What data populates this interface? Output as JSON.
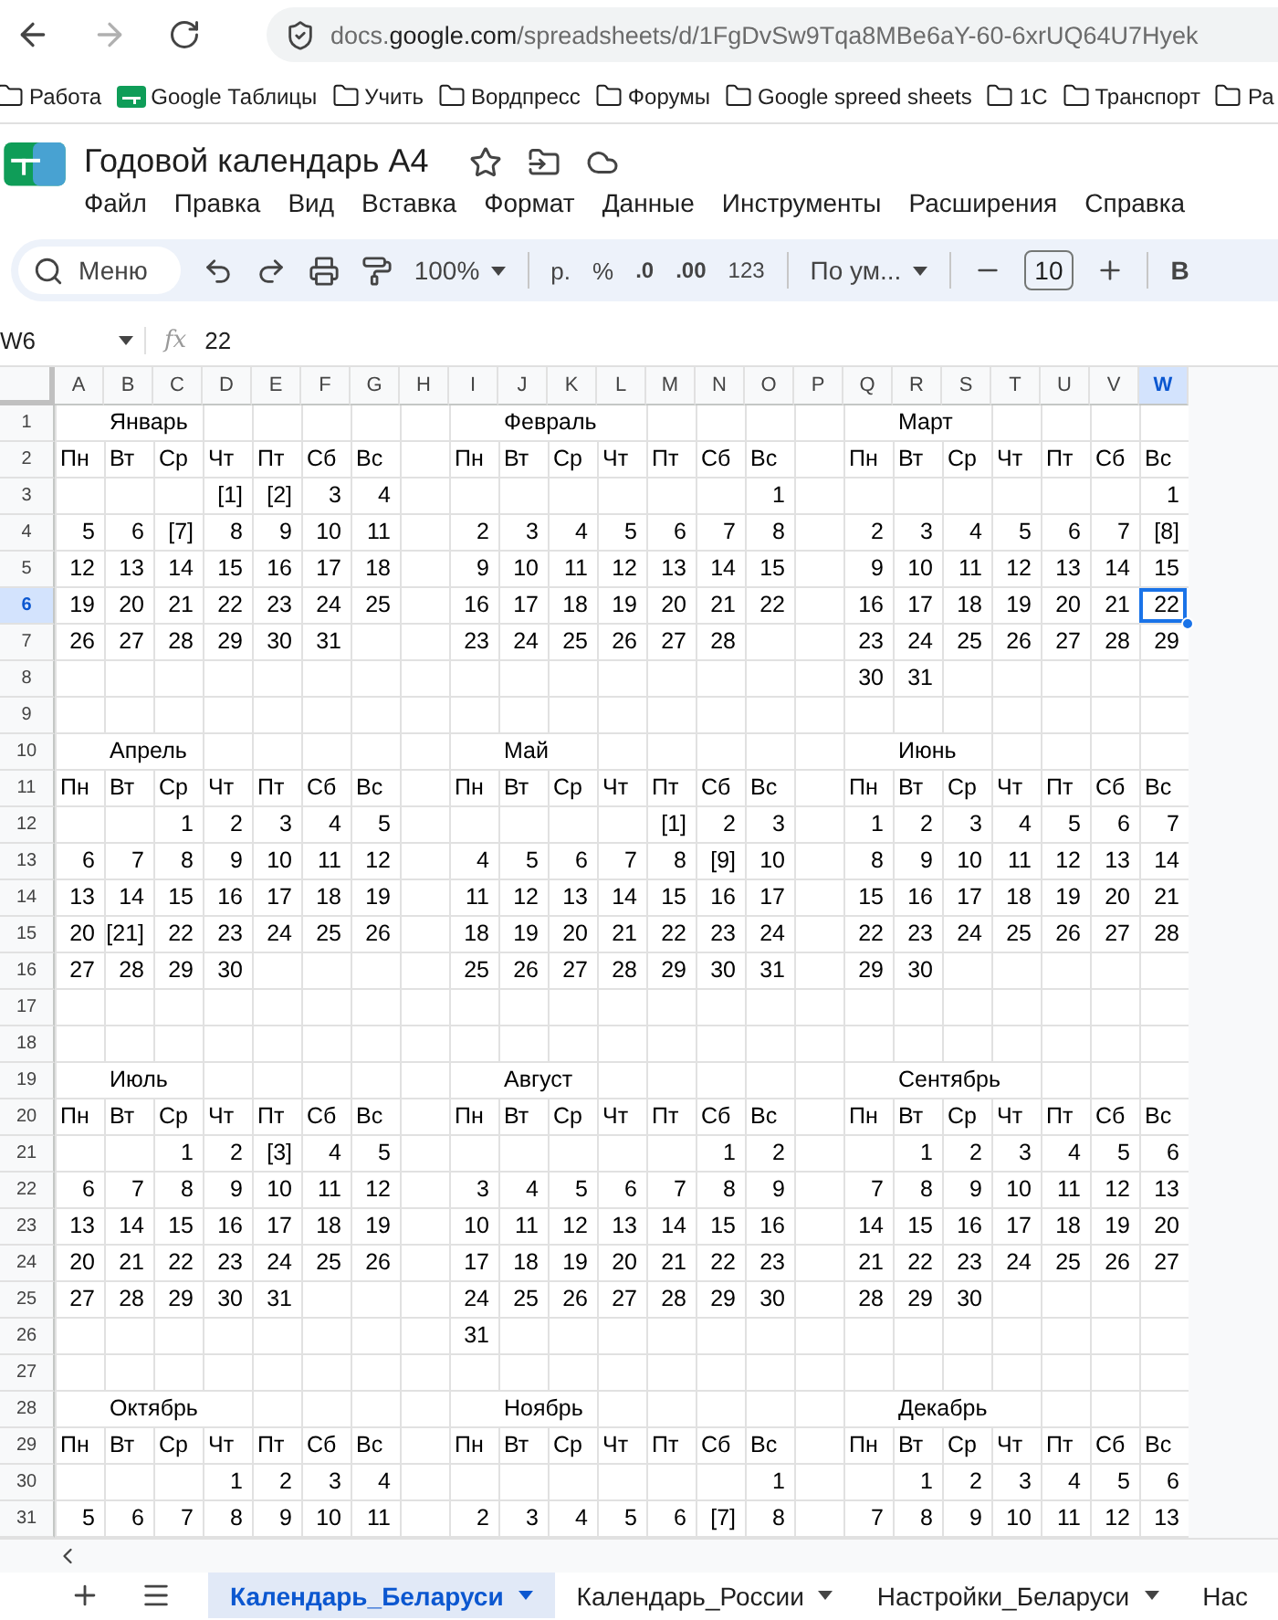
{
  "browser": {
    "url": "docs.**google.com**/spreadsheets/d/1FgDvSw9Tqa8MBe6aY-60-6xrUQ64U7Hyek"
  },
  "bookmarks": [
    {
      "label": "Работа",
      "kind": "folder"
    },
    {
      "label": "Google Таблицы",
      "kind": "sheets"
    },
    {
      "label": "Учить",
      "kind": "folder"
    },
    {
      "label": "Вордпресс",
      "kind": "folder"
    },
    {
      "label": "Форумы",
      "kind": "folder"
    },
    {
      "label": "Google spreed sheets",
      "kind": "folder"
    },
    {
      "label": "1C",
      "kind": "folder"
    },
    {
      "label": "Транспорт",
      "kind": "folder"
    },
    {
      "label": "Ра",
      "kind": "folder"
    }
  ],
  "document": {
    "title": "Годовой календарь А4"
  },
  "menu": [
    "Файл",
    "Правка",
    "Вид",
    "Вставка",
    "Формат",
    "Данные",
    "Инструменты",
    "Расширения",
    "Справка"
  ],
  "toolbar": {
    "search_label": "Меню",
    "zoom": "100%",
    "currency": "р.",
    "percent": "%",
    "decrease_decimals": ".0",
    "increase_decimals": ".00",
    "number_format": "123",
    "font": "По ум...",
    "font_size": "10",
    "bold": "B"
  },
  "formula_bar": {
    "cell_ref": "W6",
    "fx": "fx",
    "value": "22"
  },
  "columns": [
    {
      "label": "A",
      "selected": false
    },
    {
      "label": "B",
      "selected": false
    },
    {
      "label": "C",
      "selected": false
    },
    {
      "label": "D",
      "selected": false
    },
    {
      "label": "E",
      "selected": false
    },
    {
      "label": "F",
      "selected": false
    },
    {
      "label": "G",
      "selected": false
    },
    {
      "label": "H",
      "selected": false
    },
    {
      "label": "I",
      "selected": false
    },
    {
      "label": "J",
      "selected": false
    },
    {
      "label": "K",
      "selected": false
    },
    {
      "label": "L",
      "selected": false
    },
    {
      "label": "M",
      "selected": false
    },
    {
      "label": "N",
      "selected": false
    },
    {
      "label": "O",
      "selected": false
    },
    {
      "label": "P",
      "selected": false
    },
    {
      "label": "Q",
      "selected": false
    },
    {
      "label": "R",
      "selected": false
    },
    {
      "label": "S",
      "selected": false
    },
    {
      "label": "T",
      "selected": false
    },
    {
      "label": "U",
      "selected": false
    },
    {
      "label": "V",
      "selected": false
    },
    {
      "label": "W",
      "selected": true
    }
  ],
  "row_numbers": [
    {
      "label": "1",
      "selected": false
    },
    {
      "label": "2",
      "selected": false
    },
    {
      "label": "3",
      "selected": false
    },
    {
      "label": "4",
      "selected": false
    },
    {
      "label": "5",
      "selected": false
    },
    {
      "label": "6",
      "selected": true
    },
    {
      "label": "7",
      "selected": false
    },
    {
      "label": "8",
      "selected": false
    },
    {
      "label": "9",
      "selected": false
    },
    {
      "label": "10",
      "selected": false
    },
    {
      "label": "11",
      "selected": false
    },
    {
      "label": "12",
      "selected": false
    },
    {
      "label": "13",
      "selected": false
    },
    {
      "label": "14",
      "selected": false
    },
    {
      "label": "15",
      "selected": false
    },
    {
      "label": "16",
      "selected": false
    },
    {
      "label": "17",
      "selected": false
    },
    {
      "label": "18",
      "selected": false
    },
    {
      "label": "19",
      "selected": false
    },
    {
      "label": "20",
      "selected": false
    },
    {
      "label": "21",
      "selected": false
    },
    {
      "label": "22",
      "selected": false
    },
    {
      "label": "23",
      "selected": false
    },
    {
      "label": "24",
      "selected": false
    },
    {
      "label": "25",
      "selected": false
    },
    {
      "label": "26",
      "selected": false
    },
    {
      "label": "27",
      "selected": false
    },
    {
      "label": "28",
      "selected": false
    },
    {
      "label": "29",
      "selected": false
    },
    {
      "label": "30",
      "selected": false
    },
    {
      "label": "31",
      "selected": false
    }
  ],
  "months": [
    {
      "name": "Январь",
      "weekdays": [
        "Пн",
        "Вт",
        "Ср",
        "Чт",
        "Пт",
        "Сб",
        "Вс"
      ],
      "weeks": [
        [
          "[1]",
          "[2]",
          "3",
          "4"
        ],
        [
          "5",
          "6",
          "[7]",
          "8",
          "9",
          "10",
          "11"
        ],
        [
          "12",
          "13",
          "14",
          "15",
          "16",
          "17",
          "18"
        ],
        [
          "19",
          "20",
          "21",
          "22",
          "23",
          "24",
          "25"
        ],
        [
          "26",
          "27",
          "28",
          "29",
          "30",
          "31"
        ]
      ]
    },
    {
      "name": "Февраль",
      "weekdays": [
        "Пн",
        "Вт",
        "Ср",
        "Чт",
        "Пт",
        "Сб",
        "Вс"
      ],
      "weeks": [
        [
          "1"
        ],
        [
          "2",
          "3",
          "4",
          "5",
          "6",
          "7",
          "8"
        ],
        [
          "9",
          "10",
          "11",
          "12",
          "13",
          "14",
          "15"
        ],
        [
          "16",
          "17",
          "18",
          "19",
          "20",
          "21",
          "22"
        ],
        [
          "23",
          "24",
          "25",
          "26",
          "27",
          "28"
        ]
      ]
    },
    {
      "name": "Март",
      "weekdays": [
        "Пн",
        "Вт",
        "Ср",
        "Чт",
        "Пт",
        "Сб",
        "Вс"
      ],
      "weeks": [
        [
          "1"
        ],
        [
          "2",
          "3",
          "4",
          "5",
          "6",
          "7",
          "[8]"
        ],
        [
          "9",
          "10",
          "11",
          "12",
          "13",
          "14",
          "15"
        ],
        [
          "16",
          "17",
          "18",
          "19",
          "20",
          "21",
          "22"
        ],
        [
          "23",
          "24",
          "25",
          "26",
          "27",
          "28",
          "29"
        ],
        [
          "30",
          "31"
        ]
      ]
    },
    {
      "name": "Апрель",
      "weekdays": [
        "Пн",
        "Вт",
        "Ср",
        "Чт",
        "Пт",
        "Сб",
        "Вс"
      ],
      "weeks": [
        [
          "1",
          "2",
          "3",
          "4",
          "5"
        ],
        [
          "6",
          "7",
          "8",
          "9",
          "10",
          "11",
          "12"
        ],
        [
          "13",
          "14",
          "15",
          "16",
          "17",
          "18",
          "19"
        ],
        [
          "20",
          "[21]",
          "22",
          "23",
          "24",
          "25",
          "26"
        ],
        [
          "27",
          "28",
          "29",
          "30"
        ]
      ]
    },
    {
      "name": "Май",
      "weekdays": [
        "Пн",
        "Вт",
        "Ср",
        "Чт",
        "Пт",
        "Сб",
        "Вс"
      ],
      "weeks": [
        [
          "[1]",
          "2",
          "3"
        ],
        [
          "4",
          "5",
          "6",
          "7",
          "8",
          "[9]",
          "10"
        ],
        [
          "11",
          "12",
          "13",
          "14",
          "15",
          "16",
          "17"
        ],
        [
          "18",
          "19",
          "20",
          "21",
          "22",
          "23",
          "24"
        ],
        [
          "25",
          "26",
          "27",
          "28",
          "29",
          "30",
          "31"
        ]
      ]
    },
    {
      "name": "Июнь",
      "weekdays": [
        "Пн",
        "Вт",
        "Ср",
        "Чт",
        "Пт",
        "Сб",
        "Вс"
      ],
      "weeks": [
        [
          "1",
          "2",
          "3",
          "4",
          "5",
          "6",
          "7"
        ],
        [
          "8",
          "9",
          "10",
          "11",
          "12",
          "13",
          "14"
        ],
        [
          "15",
          "16",
          "17",
          "18",
          "19",
          "20",
          "21"
        ],
        [
          "22",
          "23",
          "24",
          "25",
          "26",
          "27",
          "28"
        ],
        [
          "29",
          "30"
        ]
      ]
    },
    {
      "name": "Июль",
      "weekdays": [
        "Пн",
        "Вт",
        "Ср",
        "Чт",
        "Пт",
        "Сб",
        "Вс"
      ],
      "weeks": [
        [
          "1",
          "2",
          "[3]",
          "4",
          "5"
        ],
        [
          "6",
          "7",
          "8",
          "9",
          "10",
          "11",
          "12"
        ],
        [
          "13",
          "14",
          "15",
          "16",
          "17",
          "18",
          "19"
        ],
        [
          "20",
          "21",
          "22",
          "23",
          "24",
          "25",
          "26"
        ],
        [
          "27",
          "28",
          "29",
          "30",
          "31"
        ]
      ]
    },
    {
      "name": "Август",
      "weekdays": [
        "Пн",
        "Вт",
        "Ср",
        "Чт",
        "Пт",
        "Сб",
        "Вс"
      ],
      "weeks": [
        [
          "1",
          "2"
        ],
        [
          "3",
          "4",
          "5",
          "6",
          "7",
          "8",
          "9"
        ],
        [
          "10",
          "11",
          "12",
          "13",
          "14",
          "15",
          "16"
        ],
        [
          "17",
          "18",
          "19",
          "20",
          "21",
          "22",
          "23"
        ],
        [
          "24",
          "25",
          "26",
          "27",
          "28",
          "29",
          "30"
        ],
        [
          "31"
        ]
      ]
    },
    {
      "name": "Сентябрь",
      "weekdays": [
        "Пн",
        "Вт",
        "Ср",
        "Чт",
        "Пт",
        "Сб",
        "Вс"
      ],
      "weeks": [
        [
          "1",
          "2",
          "3",
          "4",
          "5",
          "6"
        ],
        [
          "7",
          "8",
          "9",
          "10",
          "11",
          "12",
          "13"
        ],
        [
          "14",
          "15",
          "16",
          "17",
          "18",
          "19",
          "20"
        ],
        [
          "21",
          "22",
          "23",
          "24",
          "25",
          "26",
          "27"
        ],
        [
          "28",
          "29",
          "30"
        ]
      ]
    },
    {
      "name": "Октябрь",
      "weekdays": [
        "Пн",
        "Вт",
        "Ср",
        "Чт",
        "Пт",
        "Сб",
        "Вс"
      ],
      "weeks": [
        [
          "1",
          "2",
          "3",
          "4"
        ],
        [
          "5",
          "6",
          "7",
          "8",
          "9",
          "10",
          "11"
        ]
      ]
    },
    {
      "name": "Ноябрь",
      "weekdays": [
        "Пн",
        "Вт",
        "Ср",
        "Чт",
        "Пт",
        "Сб",
        "Вс"
      ],
      "weeks": [
        [
          "1"
        ],
        [
          "2",
          "3",
          "4",
          "5",
          "6",
          "[7]",
          "8"
        ]
      ]
    },
    {
      "name": "Декабрь",
      "weekdays": [
        "Пн",
        "Вт",
        "Ср",
        "Чт",
        "Пт",
        "Сб",
        "Вс"
      ],
      "weeks": [
        [
          "1",
          "2",
          "3",
          "4",
          "5",
          "6"
        ],
        [
          "7",
          "8",
          "9",
          "10",
          "11",
          "12",
          "13"
        ]
      ]
    }
  ],
  "sheet_tabs": [
    {
      "label": "Календарь_Беларуси",
      "selected": true
    },
    {
      "label": "Календарь_России",
      "selected": false
    },
    {
      "label": "Настройки_Беларуси",
      "selected": false
    },
    {
      "label": "Нас",
      "selected": false
    }
  ]
}
